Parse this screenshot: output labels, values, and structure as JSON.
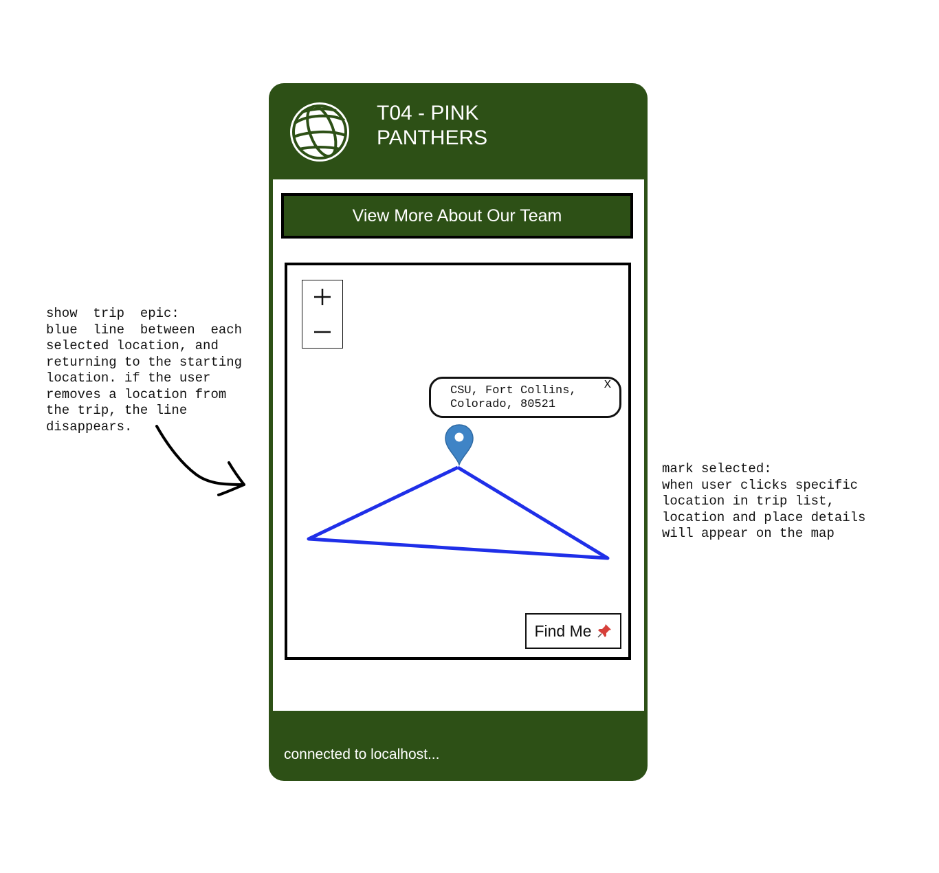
{
  "annotations": {
    "left_note": "show  trip  epic:\nblue  line  between  each\nselected location, and\nreturning to the starting\nlocation. if the user\nremoves a location from\nthe trip, the line\ndisappears.",
    "right_note": "mark selected:\nwhen user clicks specific\nlocation in trip list,\nlocation and place details\nwill appear on the map"
  },
  "header": {
    "title": "T04 - PINK PANTHERS",
    "logo_icon": "globe-icon"
  },
  "team_button": {
    "label": "View More About Our Team"
  },
  "map": {
    "zoom_in_icon": "plus-icon",
    "zoom_out_icon": "minus-icon",
    "popup": {
      "text": "CSU, Fort Collins,\nColorado, 80521",
      "close_label": "X"
    },
    "marker_icon": "map-pin-icon",
    "route_color": "#1f2fe8",
    "find_me": {
      "label": "Find Me",
      "icon": "pushpin-icon"
    }
  },
  "footer": {
    "status": "connected to localhost..."
  },
  "colors": {
    "brand_green": "#2d5016",
    "marker_blue": "#3f84c6",
    "route_blue": "#1f2fe8"
  }
}
